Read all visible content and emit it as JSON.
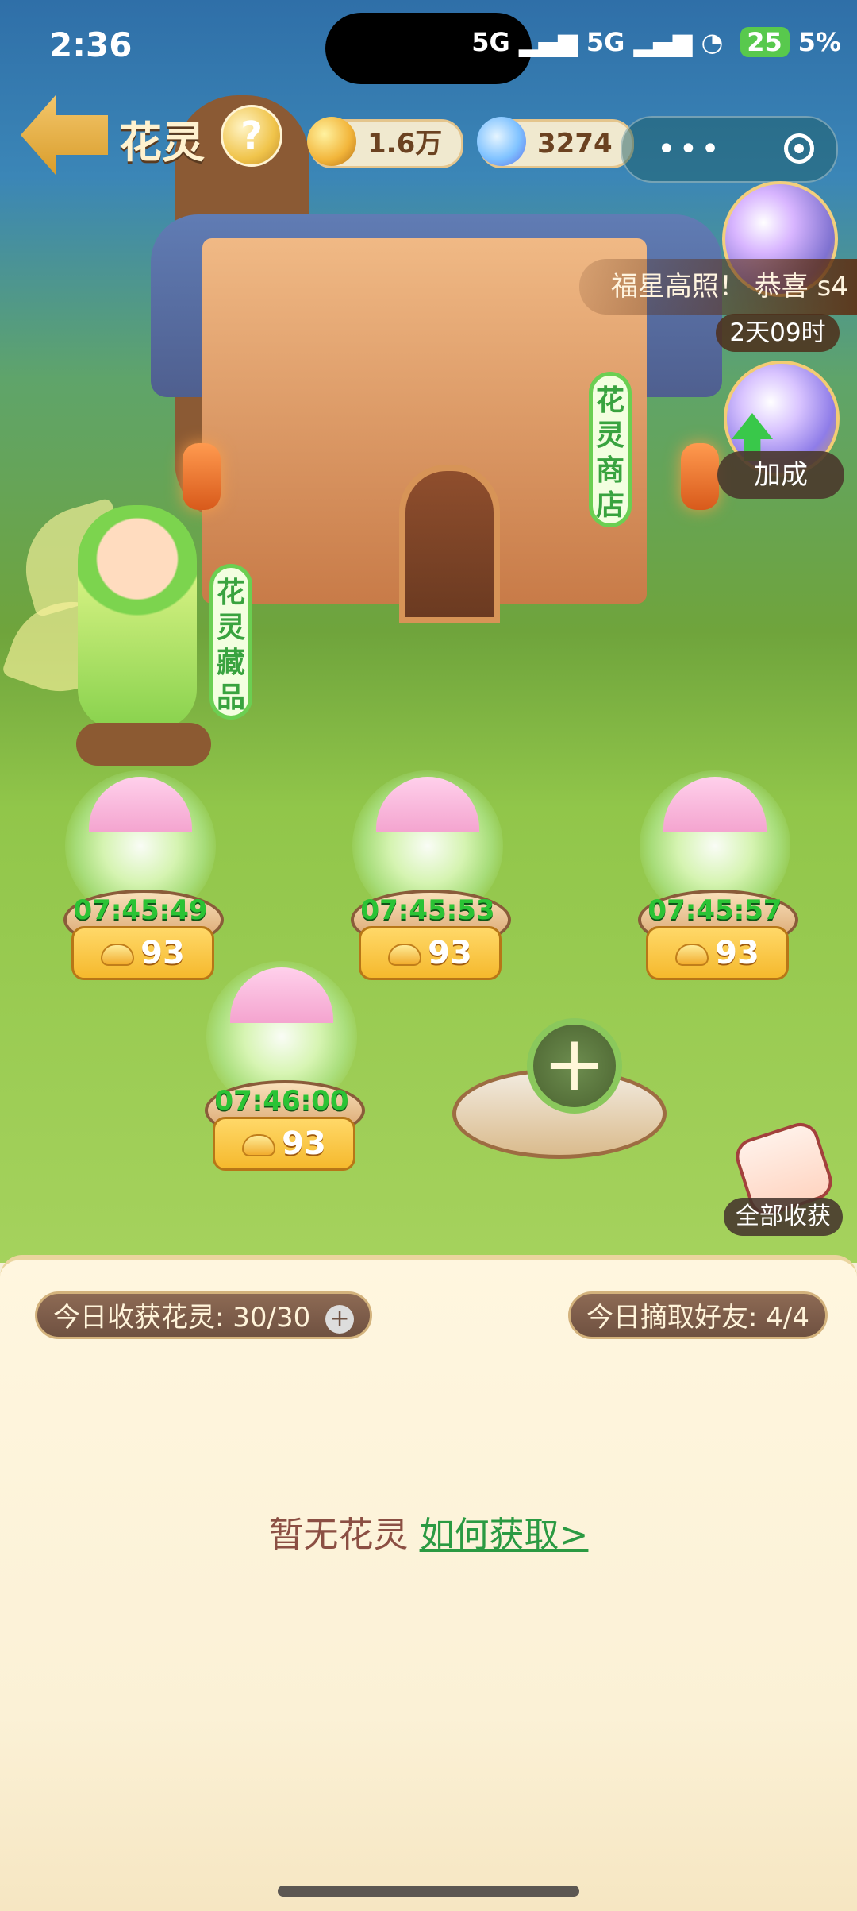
{
  "status_bar": {
    "time": "2:36",
    "network_1": "5G",
    "network_2": "5G",
    "battery": "25",
    "battery_suffix": "5%"
  },
  "header": {
    "title": "花灵",
    "help": "?",
    "gold": "1.6万",
    "stars": "3274"
  },
  "side_panel": {
    "ticker": "福星高照！ 恭喜",
    "ticker_overflow": "s4",
    "event_timer": "2天09时",
    "boost_label": "加成"
  },
  "signs": {
    "shop": [
      "花",
      "灵",
      "商",
      "店"
    ],
    "collection": [
      "花",
      "灵",
      "藏",
      "品"
    ]
  },
  "plots": [
    {
      "time": "07:45:49",
      "yield": "93"
    },
    {
      "time": "07:45:53",
      "yield": "93"
    },
    {
      "time": "07:45:57",
      "yield": "93"
    },
    {
      "time": "07:46:00",
      "yield": "93"
    }
  ],
  "buttons": {
    "collect_all": "全部收获",
    "add_plot": "+"
  },
  "panel": {
    "today_harvest": "今日收获花灵: 30/30",
    "today_friends": "今日摘取好友: 4/4",
    "empty_text": "暂无花灵",
    "empty_link": "如何获取>"
  }
}
